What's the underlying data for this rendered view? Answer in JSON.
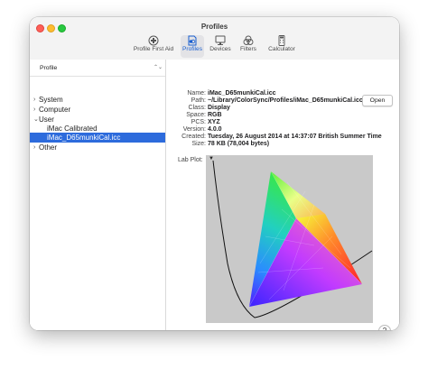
{
  "window": {
    "title": "Profiles"
  },
  "toolbar": {
    "items": [
      {
        "label": "Profile First Aid",
        "icon": "first-aid-icon"
      },
      {
        "label": "Profiles",
        "icon": "profiles-icon",
        "active": true
      },
      {
        "label": "Devices",
        "icon": "display-icon"
      },
      {
        "label": "Filters",
        "icon": "filters-icon"
      },
      {
        "label": "Calculator",
        "icon": "calculator-icon"
      }
    ]
  },
  "sidebar": {
    "dropdown_value": "Profile",
    "tree": [
      {
        "label": "System",
        "disclosure": ">"
      },
      {
        "label": "Computer",
        "disclosure": ">"
      },
      {
        "label": "User",
        "disclosure": "v"
      },
      {
        "label": "iMac Calibrated",
        "disclosure": ""
      },
      {
        "label": "iMac_D65munkiCal.icc",
        "disclosure": "",
        "selected": true
      },
      {
        "label": "Other",
        "disclosure": ">"
      }
    ]
  },
  "details": {
    "rows": [
      {
        "label": "Name:",
        "value": "iMac_D65munkiCal.icc"
      },
      {
        "label": "Path:",
        "value": "~/Library/ColorSync/Profiles/iMac_D65munkiCal.icc"
      },
      {
        "label": "Class:",
        "value": "Display"
      },
      {
        "label": "Space:",
        "value": "RGB"
      },
      {
        "label": "PCS:",
        "value": "XYZ"
      },
      {
        "label": "Version:",
        "value": "4.0.0"
      },
      {
        "label": "Created:",
        "value": "Tuesday, 26 August 2014 at 14:37:07 British Summer Time"
      },
      {
        "label": "Size:",
        "value": "78 KB (78,004 bytes)"
      }
    ],
    "open_label": "Open",
    "lab_plot_label": "Lab Plot:",
    "lab_plot_menu": "▼"
  },
  "help_label": "?",
  "colors": {
    "accent": "#2d6bdc",
    "selection": "#2d6bdc",
    "plot_bg": "#c9c9c9"
  }
}
